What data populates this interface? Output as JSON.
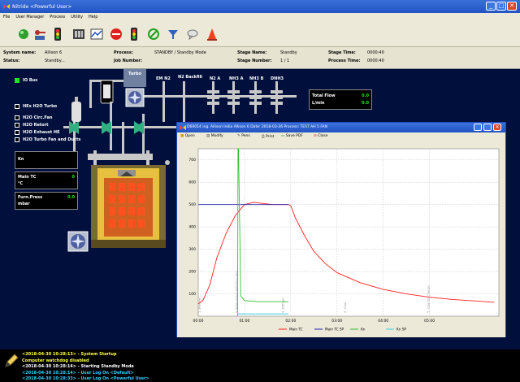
{
  "window": {
    "title": "Nitride <Powerful User>"
  },
  "menu": [
    "File",
    "User Manager",
    "Process",
    "Utility",
    "Help"
  ],
  "status_panel": {
    "system_name_label": "System name:",
    "system_name": "Allison 6",
    "status_label": "Status:",
    "status": "Standby...",
    "process_label": "Process:",
    "process": "STANDBY / Standby Mode",
    "job_number_label": "Job Number:",
    "job_number": "",
    "stage_name_label": "Stage Name:",
    "stage_name": "Standby",
    "stage_number_label": "Stage Number:",
    "stage_number": "1 / 1",
    "stage_time_label": "Stage Time:",
    "stage_time": "0000:40",
    "process_time_label": "Process Time:",
    "process_time": "0000:40"
  },
  "process_area": {
    "io_bus": "IO Bus",
    "turbo": "Turbo",
    "gas_labels": [
      "EM N2",
      "N2 Backfill",
      "N2 A",
      "NH3 A",
      "NH3 B",
      "DNH3"
    ],
    "heat_exchanger": "HEx H2O Turbo",
    "water_labels": [
      "H2O Circ.Fan",
      "H2O Retort",
      "H2O Exhaust HE",
      "H2O Turbo Fan and Ducts"
    ],
    "kn_label": "Kn",
    "main_tc_label": "Main TC",
    "main_tc_unit": "°C",
    "main_tc_value": "0",
    "furn_press_label": "Furn.Press",
    "furn_press_unit": "mbar",
    "furn_press_value": "0.0",
    "total_flow_label": "Total Flow",
    "total_flow_unit": "L/min",
    "total_flow_value": "0.0",
    "total_flow_value2": "0.0"
  },
  "trend_window": {
    "title": "D60014 ing. Allison India Allison 6 Date: 2018-03-26 Process: TEST AH 5 FAN",
    "buttons": [
      "Open",
      "Modify",
      "Pens",
      "Print",
      "Save PDF",
      "Close"
    ]
  },
  "chart_data": {
    "type": "line",
    "title": "",
    "xlabel": "",
    "ylabel": "",
    "x_ticks": [
      "00:00",
      "01:00",
      "02:00",
      "03:00",
      "04:00",
      "05:00"
    ],
    "y_ticks": [
      100,
      200,
      300,
      400,
      500,
      600,
      700
    ],
    "xlim": [
      0,
      6.5
    ],
    "ylim": [
      0,
      750
    ],
    "grid": true,
    "legend_position": "bottom",
    "annotations": [
      {
        "x": 0.05,
        "text": "1. Preheat"
      },
      {
        "x": 0.85,
        "text": "2. Heat Stage Nitriding Gas"
      },
      {
        "x": 1.85,
        "text": "3. Diffuse"
      },
      {
        "x": 3.2,
        "text": "4. Cool"
      },
      {
        "x": 5.0,
        "text": "5. Cool Discharge"
      }
    ],
    "series": [
      {
        "name": "Main TC",
        "color": "#ff2020",
        "x": [
          0,
          0.1,
          0.25,
          0.4,
          0.6,
          0.8,
          1.0,
          1.2,
          1.4,
          1.6,
          1.85,
          1.95,
          2.0,
          2.1,
          2.3,
          2.5,
          2.75,
          3.0,
          3.5,
          4.0,
          4.5,
          5.0,
          5.5,
          6.0,
          6.4
        ],
        "y": [
          55,
          70,
          140,
          260,
          370,
          450,
          500,
          510,
          505,
          500,
          500,
          500,
          495,
          440,
          360,
          290,
          235,
          195,
          150,
          120,
          100,
          85,
          75,
          68,
          62
        ]
      },
      {
        "name": "Main TC SP",
        "color": "#2020b0",
        "x": [
          0,
          1.0,
          1.95
        ],
        "y": [
          500,
          500,
          500
        ]
      },
      {
        "name": "Kn",
        "color": "#30c030",
        "x": [
          0.85,
          0.86,
          0.87,
          0.92,
          1.0,
          1.3,
          1.6,
          1.9,
          1.95
        ],
        "y": [
          0,
          750,
          750,
          90,
          70,
          65,
          65,
          65,
          65
        ]
      },
      {
        "name": "Kn SP",
        "color": "#40c8e0",
        "x": [
          0.85,
          1.0,
          1.95
        ],
        "y": [
          10,
          10,
          10
        ]
      }
    ]
  },
  "log": [
    {
      "text": "<2018-04-30 10:28:13> - System Startup",
      "color": "#ffff3c"
    },
    {
      "text": "Computer watchdog disabled",
      "color": "#ffff3c"
    },
    {
      "text": "<2018-04-30 10:28:14> - Starting Standby Mode",
      "color": "#ffffff"
    },
    {
      "text": "<2018-04-30 10:28:14> - User Log On <Default>",
      "color": "#33ccff"
    },
    {
      "text": "<2018-04-30 10:28:33> - User Log On <Powerful User>",
      "color": "#33ccff"
    }
  ]
}
